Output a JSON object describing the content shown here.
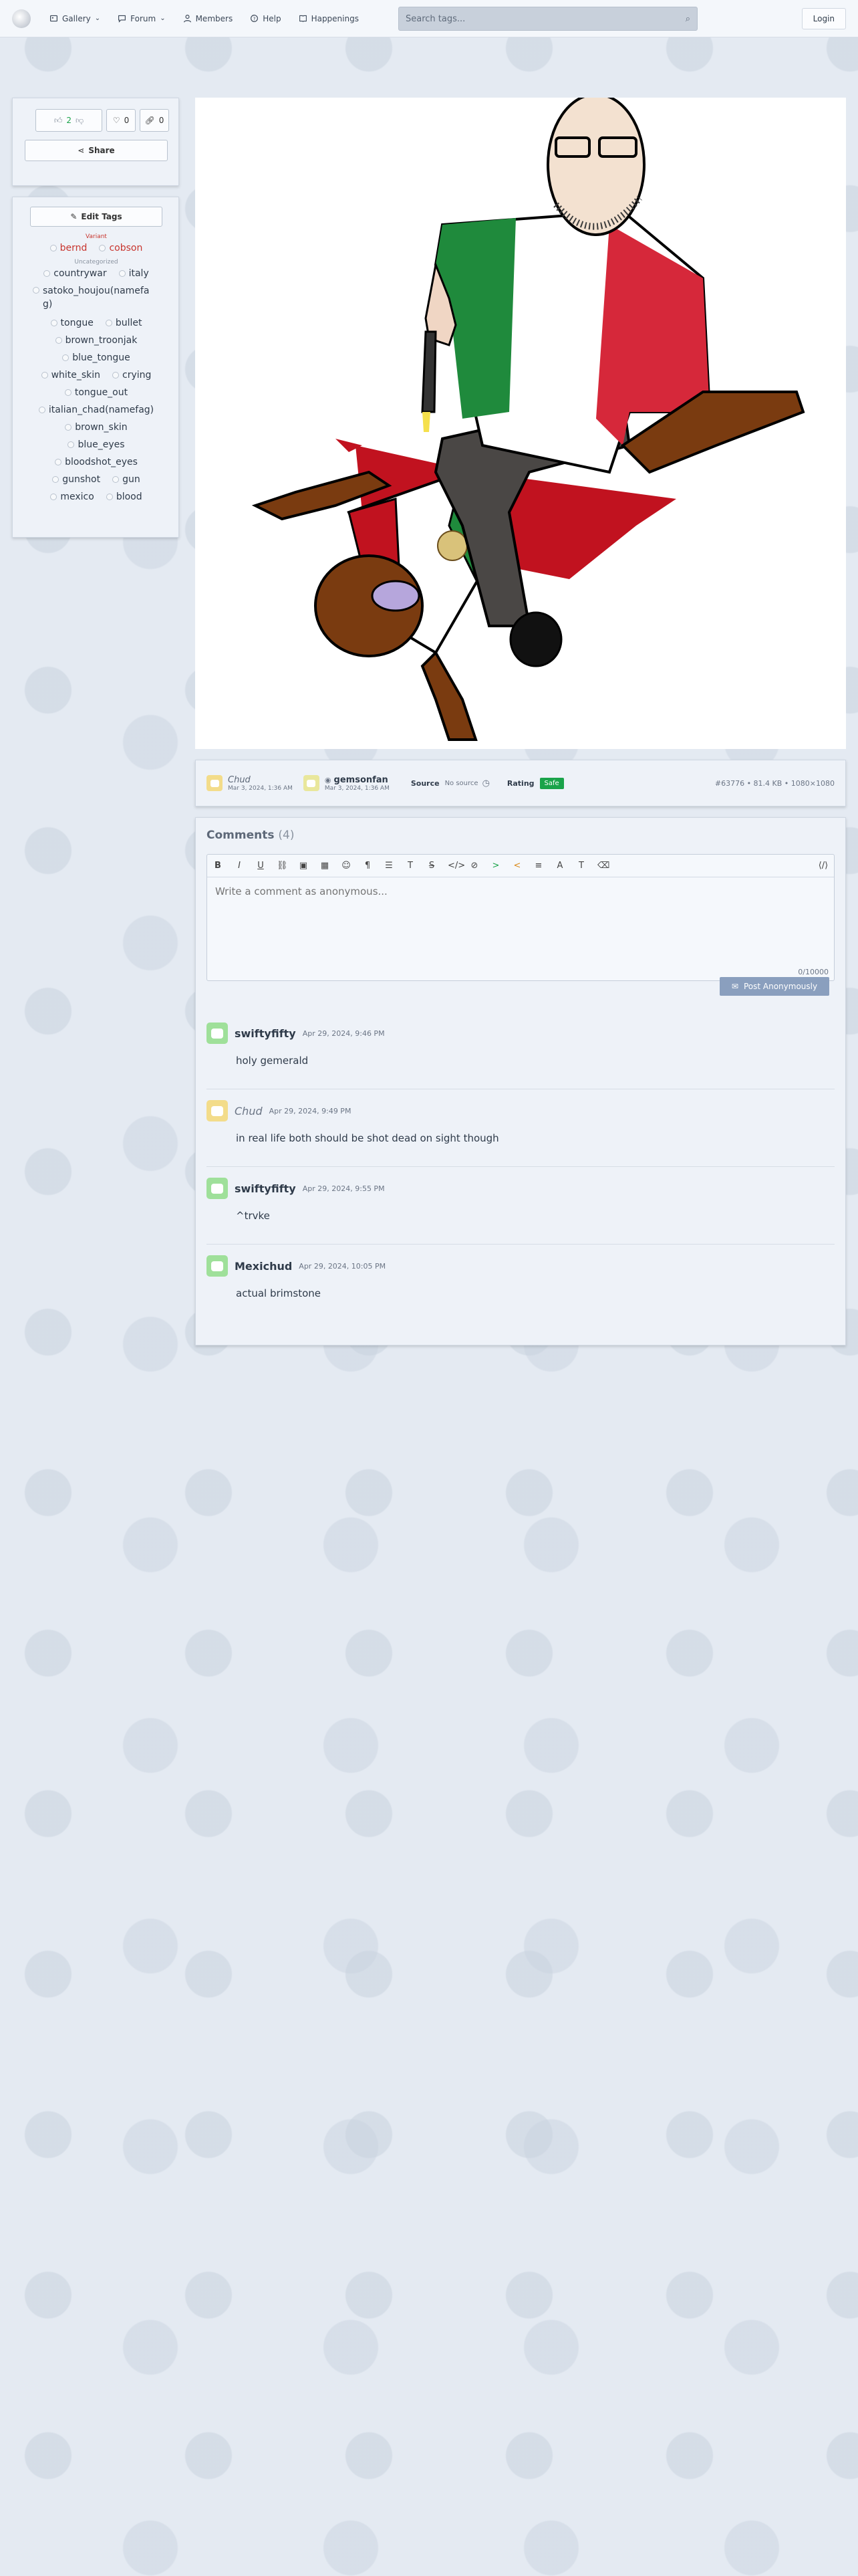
{
  "nav": {
    "gallery": "Gallery",
    "forum": "Forum",
    "members": "Members",
    "help": "Help",
    "happenings": "Happenings",
    "search_placeholder": "Search tags...",
    "login": "Login"
  },
  "votes": {
    "up_count": "2",
    "fav_count": "0",
    "share_count": "0",
    "share_label": "Share"
  },
  "tags": {
    "edit_label": "Edit Tags",
    "variant_title": "Variant",
    "variant": [
      "bernd",
      "cobson"
    ],
    "uncategorized_title": "Uncategorized",
    "items": [
      "countrywar",
      "italy",
      "satoko_houjou(namefag)",
      "tongue",
      "bullet",
      "brown_troonjak",
      "blue_tongue",
      "white_skin",
      "crying",
      "tongue_out",
      "italian_chad(namefag)",
      "brown_skin",
      "blue_eyes",
      "bloodshot_eyes",
      "gunshot",
      "gun",
      "mexico",
      "blood"
    ]
  },
  "meta": {
    "uploader_name": "Chud",
    "uploader_date": "Mar 3, 2024, 1:36 AM",
    "approver_name": "gemsonfan",
    "approver_date": "Mar 3, 2024, 1:36 AM",
    "source_label": "Source",
    "source_value": "No source",
    "rating_label": "Rating",
    "rating_value": "Safe",
    "file_info": "#63776 • 81.4 KB • 1080×1080"
  },
  "comments": {
    "title": "Comments",
    "count": "(4)",
    "placeholder": "Write a comment as anonymous...",
    "char_count": "0/10000",
    "post_label": "Post Anonymously",
    "list": [
      {
        "name": "swiftyfifty",
        "date": "Apr 29, 2024, 9:46 PM",
        "text": "holy gemerald"
      },
      {
        "name": "Chud",
        "date": "Apr 29, 2024, 9:49 PM",
        "text": "in real life both should be shot dead on sight though"
      },
      {
        "name": "swiftyfifty",
        "date": "Apr 29, 2024, 9:55 PM",
        "text": "^trvke"
      },
      {
        "name": "Mexichud",
        "date": "Apr 29, 2024, 10:05 PM",
        "text": "actual brimstone"
      }
    ]
  },
  "colors": {
    "accent": "#1aa34a",
    "variant_red": "#c8352e",
    "button_blue": "#8a9fbe",
    "safe_green": "#1aa34a"
  }
}
